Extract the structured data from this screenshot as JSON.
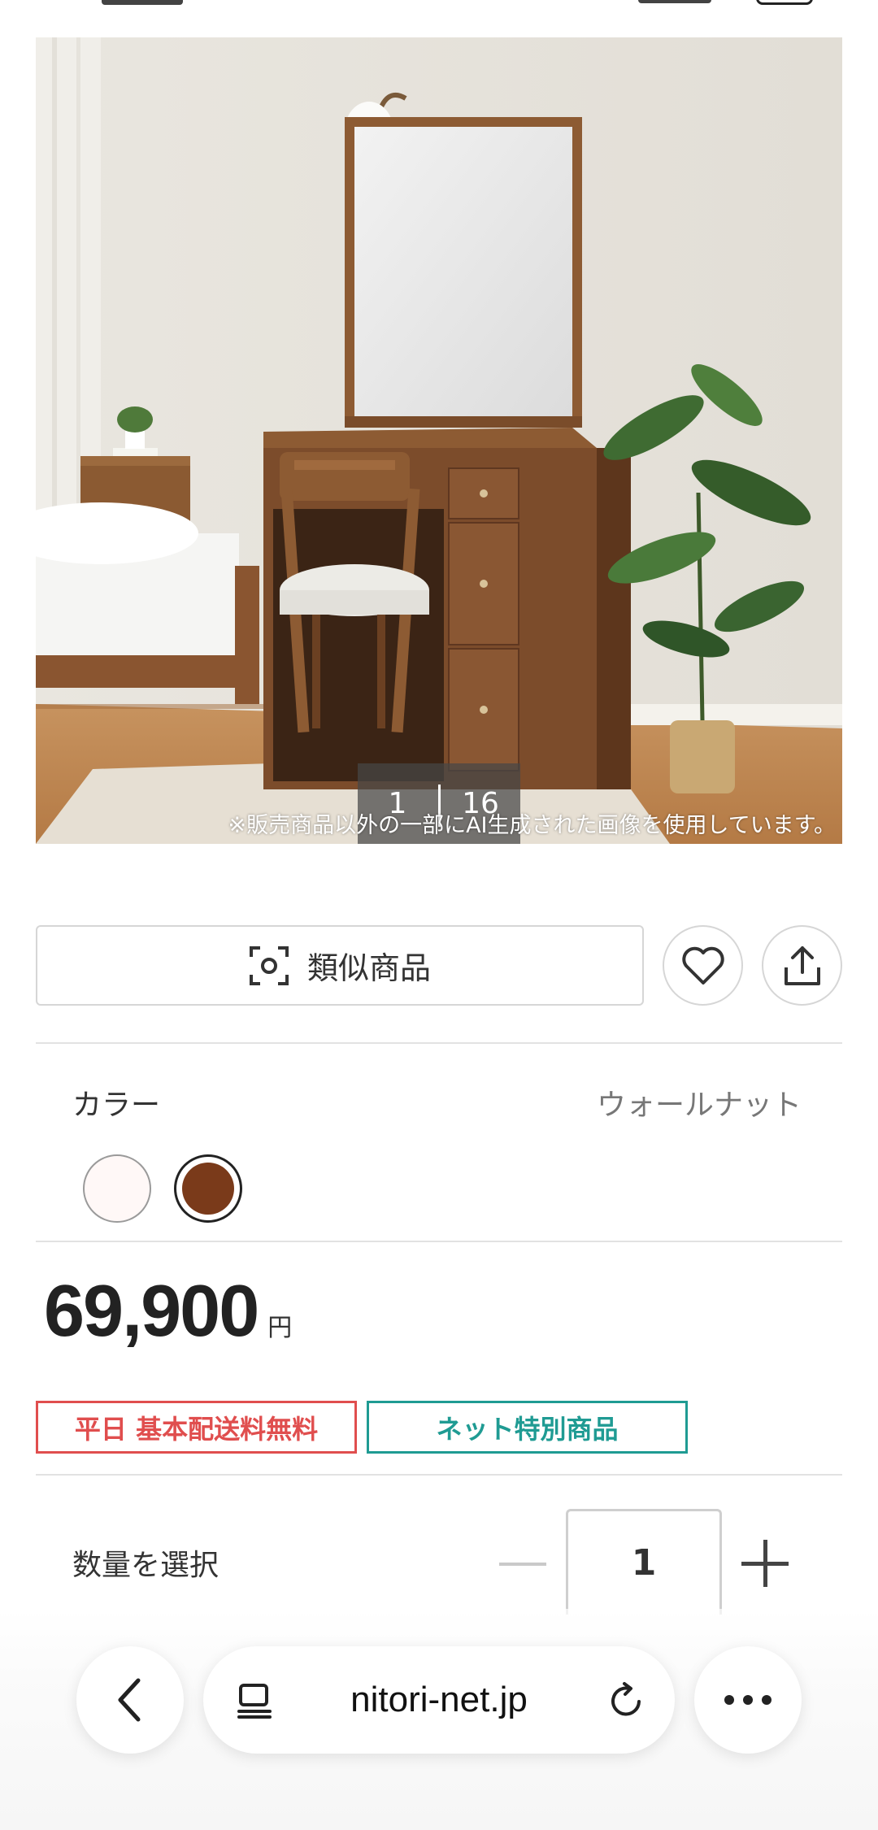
{
  "hero": {
    "counter_current": "1",
    "counter_total": "16",
    "ai_note": "※販売商品以外の一部にAI生成された画像を使用しています。"
  },
  "actions": {
    "similar_label": "類似商品"
  },
  "color": {
    "title": "カラー",
    "selected_name": "ウォールナット",
    "swatches": [
      {
        "name": "white",
        "hex": "#fff8f7"
      },
      {
        "name": "walnut",
        "hex": "#7a3a1a",
        "selected": true
      }
    ]
  },
  "price": {
    "amount": "69,900",
    "unit": "円"
  },
  "badges": {
    "shipping": "平日 基本配送料無料",
    "online": "ネット特別商品"
  },
  "quantity": {
    "label": "数量を選択",
    "value": "1"
  },
  "browser": {
    "url": "nitori-net.jp"
  },
  "colors": {
    "badge_red": "#e04e4e",
    "badge_green": "#1f9b93"
  }
}
